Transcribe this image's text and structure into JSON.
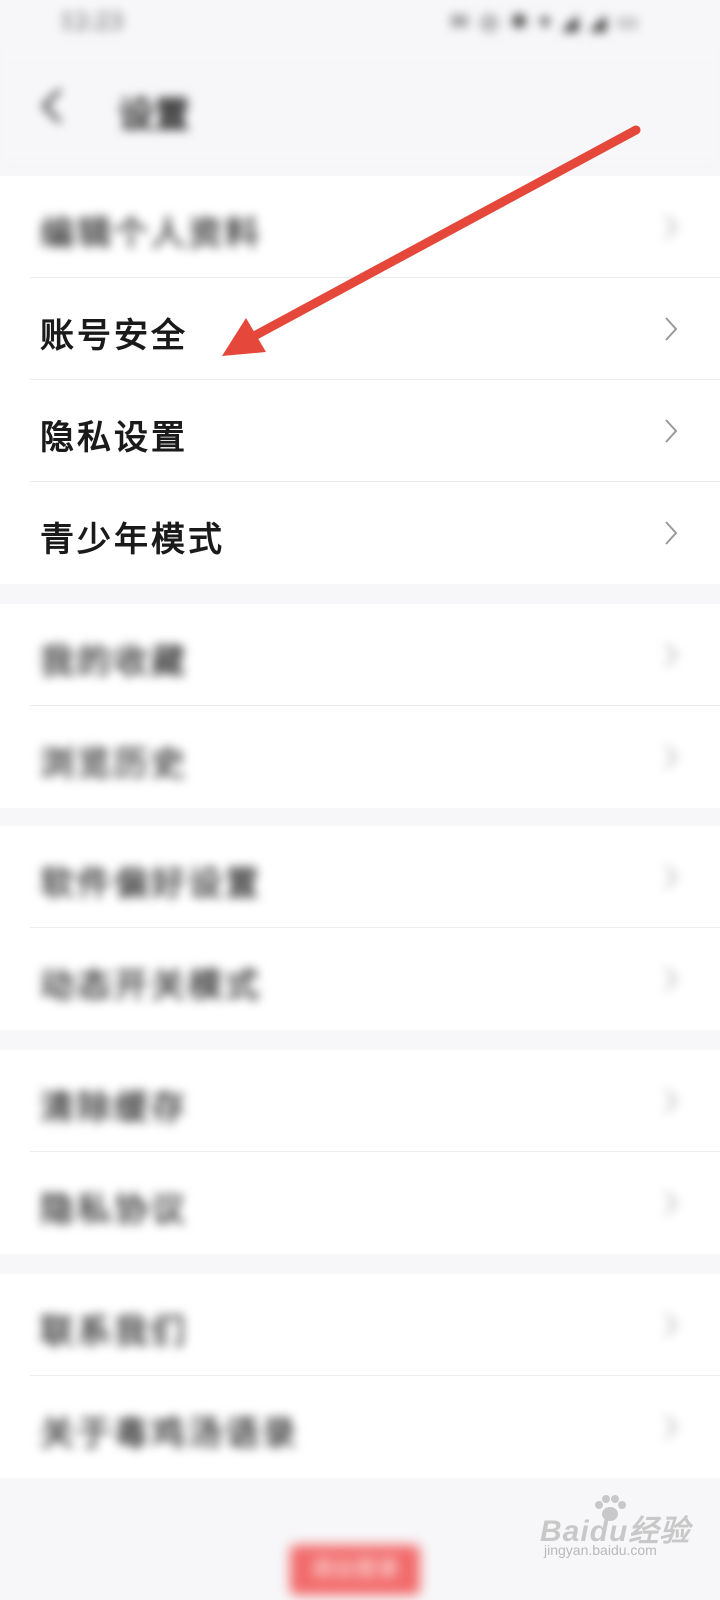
{
  "status_bar": {
    "time": "12:23",
    "icons": "✉ ◎ ✱ ▾ ◢ ◢ ▭"
  },
  "header": {
    "title": "设置",
    "back_icon": "chevron-left-icon"
  },
  "sections": [
    {
      "rows": [
        {
          "label": "编辑个人资料",
          "blurred": true
        },
        {
          "label": "账号安全",
          "blurred": false
        },
        {
          "label": "隐私设置",
          "blurred": false
        },
        {
          "label": "青少年模式",
          "blurred": false
        }
      ]
    },
    {
      "rows": [
        {
          "label": "我的收藏",
          "blurred": true
        },
        {
          "label": "浏览历史",
          "blurred": true
        }
      ]
    },
    {
      "rows": [
        {
          "label": "软件偏好设置",
          "blurred": true
        },
        {
          "label": "动态开关模式",
          "blurred": true
        }
      ]
    },
    {
      "rows": [
        {
          "label": "清除缓存",
          "blurred": true
        },
        {
          "label": "隐私协议",
          "blurred": true
        }
      ]
    },
    {
      "rows": [
        {
          "label": "联系我们",
          "blurred": true
        },
        {
          "label": "关于毒鸡汤语录",
          "blurred": true
        }
      ]
    }
  ],
  "logout": {
    "label": "退出登录"
  },
  "annotation": {
    "color": "#e5483a",
    "points_to": "账号安全"
  },
  "watermark": {
    "brand": "Baidu经验",
    "url": "jingyan.baidu.com"
  },
  "colors": {
    "background": "#f7f7f9",
    "row_bg": "#ffffff",
    "chevron": "#9a9a9a"
  }
}
